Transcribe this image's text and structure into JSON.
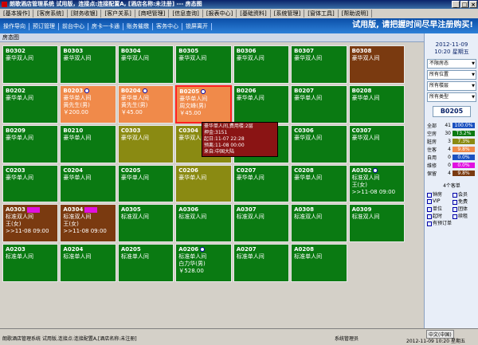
{
  "window": {
    "title": "朗歌酒店管理系统 试用版，连接点:连接配置A, [酒店名称:未注册] --- 房态图"
  },
  "menu": [
    "[基本操作]",
    "[客房系统]",
    "[财务收银]",
    "[客户关系]",
    "[商吧管理]",
    "[信息查询]",
    "[报表中心]",
    "[基础资料]",
    "[系统管理]",
    "[窗体工具]",
    "[帮助说明]"
  ],
  "toolbar": {
    "items": [
      "操作导向",
      "预订管理",
      "前台中心",
      "房卡一卡通",
      "账务催缴",
      "客务中心",
      "锁屏离开"
    ],
    "slogan": "试用版, 请把握时间尽早注册购买!"
  },
  "section": {
    "title": "房态图"
  },
  "rooms": [
    {
      "num": "B0302",
      "type": "豪华双人间",
      "color": "green"
    },
    {
      "num": "B0303",
      "type": "豪华双人间",
      "color": "green"
    },
    {
      "num": "B0304",
      "type": "豪华双人间",
      "color": "green"
    },
    {
      "num": "B0305",
      "type": "豪华双人间",
      "color": "green"
    },
    {
      "num": "B0306",
      "type": "豪华双人间",
      "color": "green"
    },
    {
      "num": "B0307",
      "type": "豪华双人间",
      "color": "green"
    },
    {
      "num": "B0308",
      "type": "豪华双人间",
      "color": "brown"
    },
    {
      "num": "B0202",
      "type": "豪华单人间",
      "color": "green"
    },
    {
      "num": "B0203",
      "type": "豪华单人间",
      "color": "orange",
      "guest": "黄先生(男)",
      "amount": "￥200.00"
    },
    {
      "num": "B0204",
      "type": "豪华单人间",
      "color": "orange",
      "guest": "黄先生(男)",
      "amount": "￥45.00"
    },
    {
      "num": "B0205",
      "type": "豪华单人间",
      "color": "orange",
      "guest": "周文峰(男)",
      "amount": "￥45.00",
      "selected": true
    },
    {
      "num": "B0206",
      "type": "豪华单人间",
      "color": "green"
    },
    {
      "num": "B0207",
      "type": "豪华单人间",
      "color": "green"
    },
    {
      "num": "B0208",
      "type": "豪华单人间",
      "color": "green"
    },
    {
      "num": "B0209",
      "type": "豪华单人间",
      "color": "green"
    },
    {
      "num": "B0210",
      "type": "豪华单人间",
      "color": "green"
    },
    {
      "num": "C0303",
      "type": "豪华双人间",
      "color": "olive"
    },
    {
      "num": "C0304",
      "type": "豪华双人间",
      "color": "olive"
    },
    {
      "num": "C0305",
      "type": "豪华双人间",
      "color": "green"
    },
    {
      "num": "C0306",
      "type": "豪华双人间",
      "color": "green"
    },
    {
      "num": "C0307",
      "type": "豪华双人间",
      "color": "green"
    },
    {
      "num": "C0203",
      "type": "豪华单人间",
      "color": "green"
    },
    {
      "num": "C0204",
      "type": "豪华单人间",
      "color": "green"
    },
    {
      "num": "C0205",
      "type": "豪华单人间",
      "color": "green"
    },
    {
      "num": "C0206",
      "type": "豪华单人间",
      "color": "olive"
    },
    {
      "num": "C0207",
      "type": "豪华单人间",
      "color": "green"
    },
    {
      "num": "C0208",
      "type": "豪华单人间",
      "color": "green"
    },
    {
      "num": "A0302",
      "type": "标准双人间",
      "color": "green",
      "guest": "王(女)",
      "amount": ">>11-08 09:00"
    },
    {
      "num": "A0303",
      "type": "标准双人间",
      "color": "brown",
      "guest": "王(女)",
      "amount": ">>11-08 09:00"
    },
    {
      "num": "A0304",
      "type": "标准双人间",
      "color": "brown",
      "guest": "王(女)",
      "amount": ">>11-08 09:00"
    },
    {
      "num": "A0305",
      "type": "标准双人间",
      "color": "green"
    },
    {
      "num": "A0306",
      "type": "标准双人间",
      "color": "green"
    },
    {
      "num": "A0307",
      "type": "标准双人间",
      "color": "green"
    },
    {
      "num": "A0308",
      "type": "标准双人间",
      "color": "green"
    },
    {
      "num": "A0309",
      "type": "标准双人间",
      "color": "green"
    },
    {
      "num": "A0203",
      "type": "标准单人间",
      "color": "green"
    },
    {
      "num": "A0204",
      "type": "标准单人间",
      "color": "green"
    },
    {
      "num": "A0205",
      "type": "标准单人间",
      "color": "green"
    },
    {
      "num": "A0206",
      "type": "标准单人间",
      "color": "green",
      "guest": "白力华(男)",
      "amount": "￥528.00"
    },
    {
      "num": "A0207",
      "type": "标准单人间",
      "color": "green"
    },
    {
      "num": "A0208",
      "type": "标准单人间",
      "color": "green"
    }
  ],
  "tooltip": [
    "豪华单人间,费用楼:2层",
    "押金:3151",
    "起日:11-07 22:28",
    "预离:11-08 00:00",
    "来自:中国大陆"
  ],
  "panel": {
    "date": "2012-11-09",
    "time": "10:20 星期五",
    "filters": [
      "不限房态",
      "所有位置",
      "所有楼层",
      "所有类型"
    ],
    "selected_room": "B0205",
    "stats": [
      {
        "label": "全部",
        "count": "41",
        "bar": "100.0%",
        "color": "#1a50c0"
      },
      {
        "label": "空房",
        "count": "30",
        "bar": "T3.2%",
        "color": "#0a7a12"
      },
      {
        "label": "脏房",
        "count": "3",
        "bar": "7.3%",
        "color": "#8a8a12"
      },
      {
        "label": "住客",
        "count": "4",
        "bar": "9.8%",
        "color": "#f08a4a"
      },
      {
        "label": "自用",
        "count": "0",
        "bar": "0.0%",
        "color": "#1a50c0"
      },
      {
        "label": "维修",
        "count": "0",
        "bar": "0.0%",
        "color": "#e010e0"
      },
      {
        "label": "保留",
        "count": "4",
        "bar": "9.8%",
        "color": "#7a3a10"
      }
    ],
    "legend_title": "4个客单",
    "legend": [
      "钟房",
      "会员",
      "VIP",
      "免费",
      "单位",
      "团体",
      "起时",
      "续租",
      "有预订单"
    ]
  },
  "statusbar": {
    "left": "朗歌酒店管理系统 试用版,连接点:连接配置A,[酒店名称:未注册]",
    "user": "系统管理员",
    "ime": "中文(中国)",
    "datetime": "2012-11-09 10:20 星期五"
  }
}
